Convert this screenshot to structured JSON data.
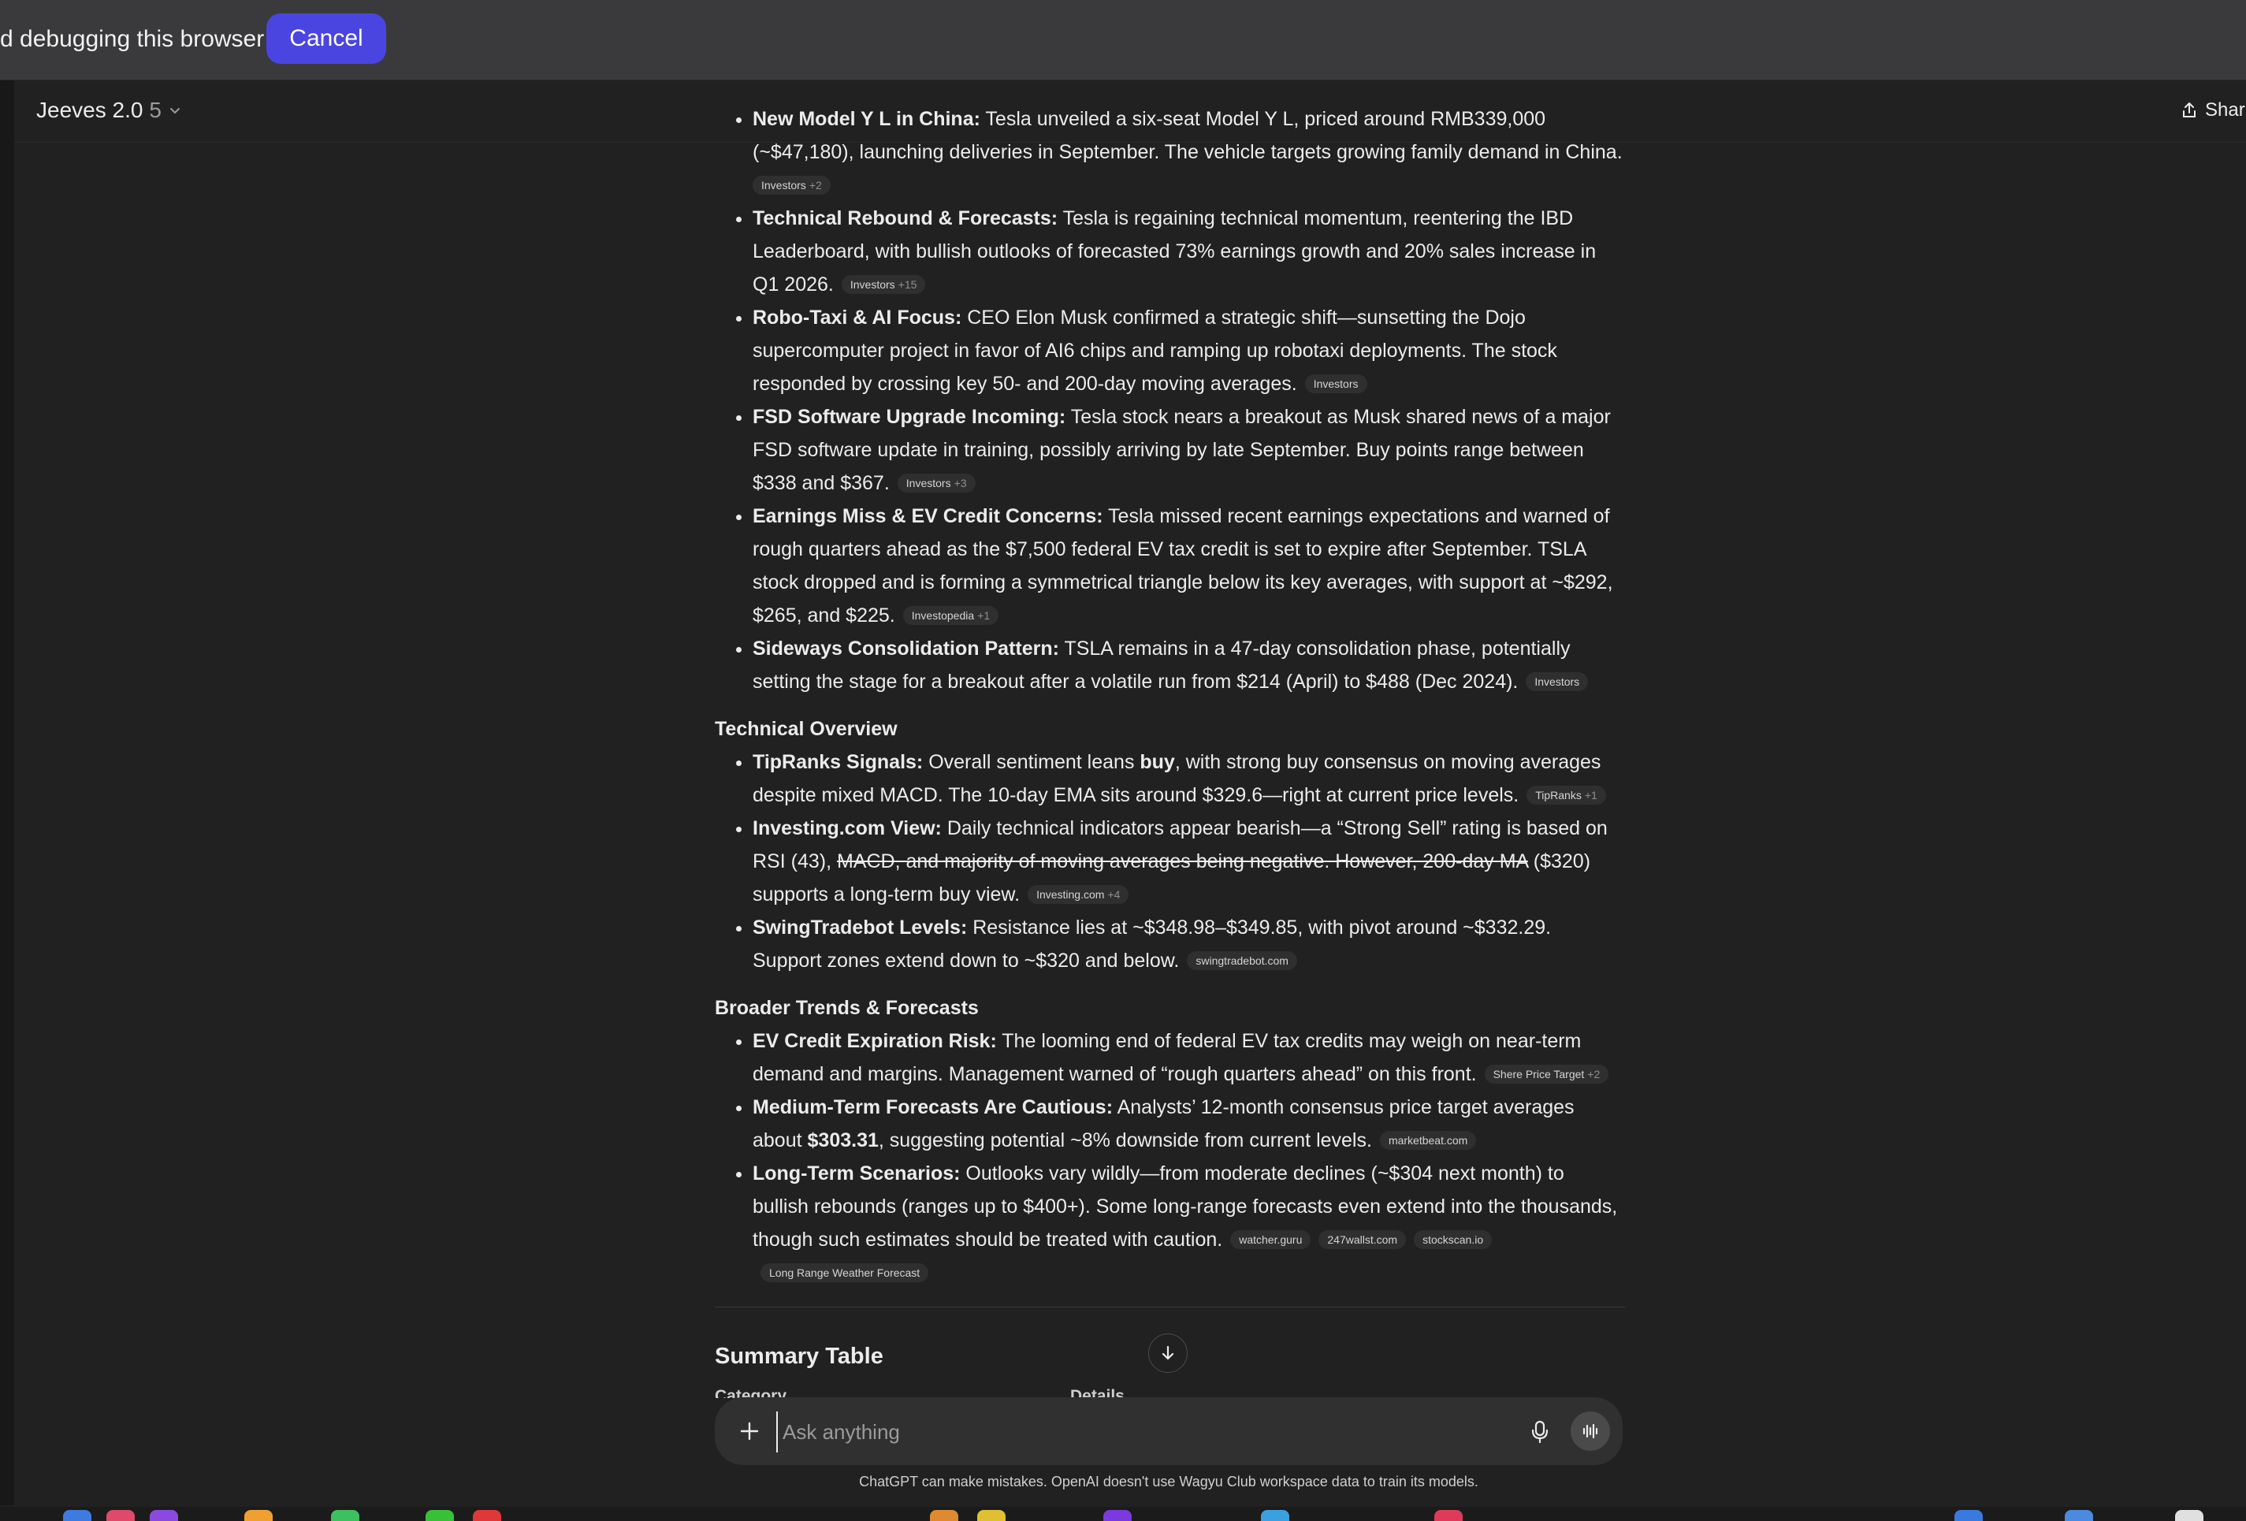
{
  "banner": {
    "text": "d debugging this browser",
    "cancel_label": "Cancel"
  },
  "header": {
    "model_name": "Jeeves 2.0",
    "model_version": "5",
    "share_label": "Shar"
  },
  "intro_items": [
    {
      "bold": "New Model Y L in China:",
      "text": " Tesla unveiled a six-seat Model Y L, priced around RMB339,000 (~$47,180), launching deliveries in September. The vehicle targets growing family demand in China.",
      "pill": "Investors",
      "pill_plus": "+2"
    },
    {
      "bold": "Technical Rebound & Forecasts:",
      "text": " Tesla is regaining technical momentum, reentering the IBD Leaderboard, with bullish outlooks of forecasted 73% earnings growth and 20% sales increase in Q1 2026.",
      "pill": "Investors",
      "pill_plus": "+15"
    },
    {
      "bold": "Robo-Taxi & AI Focus:",
      "text": " CEO Elon Musk confirmed a strategic shift—sunsetting the Dojo supercomputer project in favor of AI6 chips and ramping up robotaxi deployments. The stock responded by crossing key 50- and 200-day moving averages.",
      "pill": "Investors",
      "pill_plus": ""
    },
    {
      "bold": "FSD Software Upgrade Incoming:",
      "text": " Tesla stock nears a breakout as Musk shared news of a major FSD software update in training, possibly arriving by late September. Buy points range between $338 and $367.",
      "pill": "Investors",
      "pill_plus": "+3"
    },
    {
      "bold": "Earnings Miss & EV Credit Concerns:",
      "text": " Tesla missed recent earnings expectations and warned of rough quarters ahead as the $7,500 federal EV tax credit is set to expire after September. TSLA stock dropped and is forming a symmetrical triangle below its key averages, with support at ~$292, $265, and $225.",
      "pill": "Investopedia",
      "pill_plus": "+1"
    },
    {
      "bold": "Sideways Consolidation Pattern:",
      "text": " TSLA remains in a 47-day consolidation phase, potentially setting the stage for a breakout after a volatile run from $214 (April) to $488 (Dec 2024).",
      "pill": "Investors",
      "pill_plus": ""
    }
  ],
  "technical": {
    "heading": "Technical Overview",
    "tipranks": {
      "bold": "TipRanks Signals:",
      "text1": " Overall sentiment leans ",
      "bold2": "buy",
      "text2": ", with strong buy consensus on moving averages despite mixed MACD. The 10-day EMA sits around $329.6—right at current price levels.",
      "pill": "TipRanks",
      "pill_plus": "+1"
    },
    "investing": {
      "bold": "Investing.com View:",
      "text1": " Daily technical indicators appear bearish—a “Strong Sell” rating is based on RSI (43), ",
      "strike": "MACD, and majority of moving averages being negative. However, 200-day MA",
      "text2": " ($320) supports a long-term buy view.",
      "pill": "Investing.com",
      "pill_plus": "+4"
    },
    "swing": {
      "bold": "SwingTradebot Levels:",
      "text": " Resistance lies at ~$348.98–$349.85, with pivot around ~$332.29. Support zones extend down to ~$320 and below.",
      "pill": "swingtradebot.com"
    }
  },
  "broader": {
    "heading": "Broader Trends & Forecasts",
    "ev": {
      "bold": "EV Credit Expiration Risk:",
      "text": " The looming end of federal EV tax credits may weigh on near-term demand and margins. Management warned of “rough quarters ahead” on this front.",
      "pill": "Shere Price Target",
      "pill_plus": "+2"
    },
    "medium": {
      "bold": "Medium-Term Forecasts Are Cautious:",
      "text1": " Analysts’ 12-month consensus price target averages about ",
      "bold2": "$303.31",
      "text2": ", suggesting potential ~8% downside from current levels.",
      "pill": "marketbeat.com"
    },
    "long": {
      "bold": "Long-Term Scenarios:",
      "text": " Outlooks vary wildly—from moderate declines (~$304 next month) to bullish rebounds (ranges up to $400+). Some long-range forecasts even extend into the thousands, though such estimates should be treated with caution.",
      "pills": [
        "watcher.guru",
        "247wallst.com",
        "stockscan.io",
        "Long Range Weather Forecast"
      ]
    }
  },
  "summary": {
    "title": "Summary Table",
    "col_category": "Category",
    "col_details": "Details"
  },
  "composer": {
    "placeholder": "Ask anything"
  },
  "disclaimer": "ChatGPT can make mistakes. OpenAI doesn't use Wagyu Club workspace data to train its models.",
  "colors": {
    "background": "#212121",
    "banner": "#3a3a3c",
    "cancel_button": "#4a45e0",
    "composer": "#303030"
  }
}
